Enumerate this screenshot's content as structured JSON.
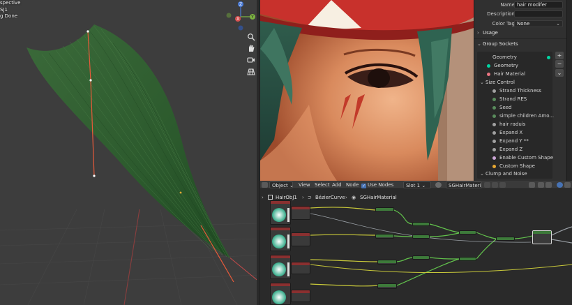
{
  "viewport": {
    "overlay_line1": "spective",
    "overlay_line2": "SJ1",
    "overlay_line3": "g Done",
    "gizmo_axes": [
      "Z",
      "X",
      "Y"
    ],
    "nav_icons": [
      "zoom-icon",
      "pan-hand-icon",
      "camera-icon",
      "grid-view-icon"
    ],
    "colors": {
      "background": "#3d3d3d",
      "hair": "#2e5a2e",
      "curve": "#e85a3a"
    }
  },
  "properties": {
    "name_label": "Name",
    "name_value": "hair modifer",
    "description_label": "Description",
    "description_value": "",
    "color_tag_label": "Color Tag",
    "color_tag_value": "None",
    "usage_label": "Usage",
    "group_sockets_label": "Group Sockets",
    "sockets": [
      {
        "label": "Geometry",
        "color": "#00d6a3"
      },
      {
        "label": "Geometry",
        "color": "#00d6a3"
      },
      {
        "label": "Hair Material",
        "color": "#eb7582"
      }
    ],
    "size_control_label": "Size Control",
    "size_control_items": [
      {
        "label": "Strand Thickness",
        "color": "#a1a1a1"
      },
      {
        "label": "Strand RES",
        "color": "#598c5c"
      },
      {
        "label": "Seed",
        "color": "#598c5c"
      },
      {
        "label": "simple children Amo...",
        "color": "#598c5c"
      },
      {
        "label": "hair raduis",
        "color": "#a1a1a1"
      },
      {
        "label": "Expand X",
        "color": "#a1a1a1"
      },
      {
        "label": "Expand Y **",
        "color": "#a1a1a1"
      },
      {
        "label": "Expand Z",
        "color": "#a1a1a1"
      },
      {
        "label": "Enable Custom Shape",
        "color": "#cca6d6"
      },
      {
        "label": "Custom Shape",
        "color": "#e8a832"
      }
    ],
    "clump_noise_label": "Clump and Noise",
    "side_buttons": [
      "+",
      "−",
      "⌄"
    ]
  },
  "node_editor": {
    "header": {
      "mode": "Object",
      "menus": [
        "View",
        "Select",
        "Add",
        "Node"
      ],
      "use_nodes_label": "Use Nodes",
      "slot": "Slot 1",
      "material": "SGHairMaterial"
    },
    "breadcrumb": [
      "HairObJ1",
      "BézierCurve",
      "SGHairMaterial"
    ]
  }
}
